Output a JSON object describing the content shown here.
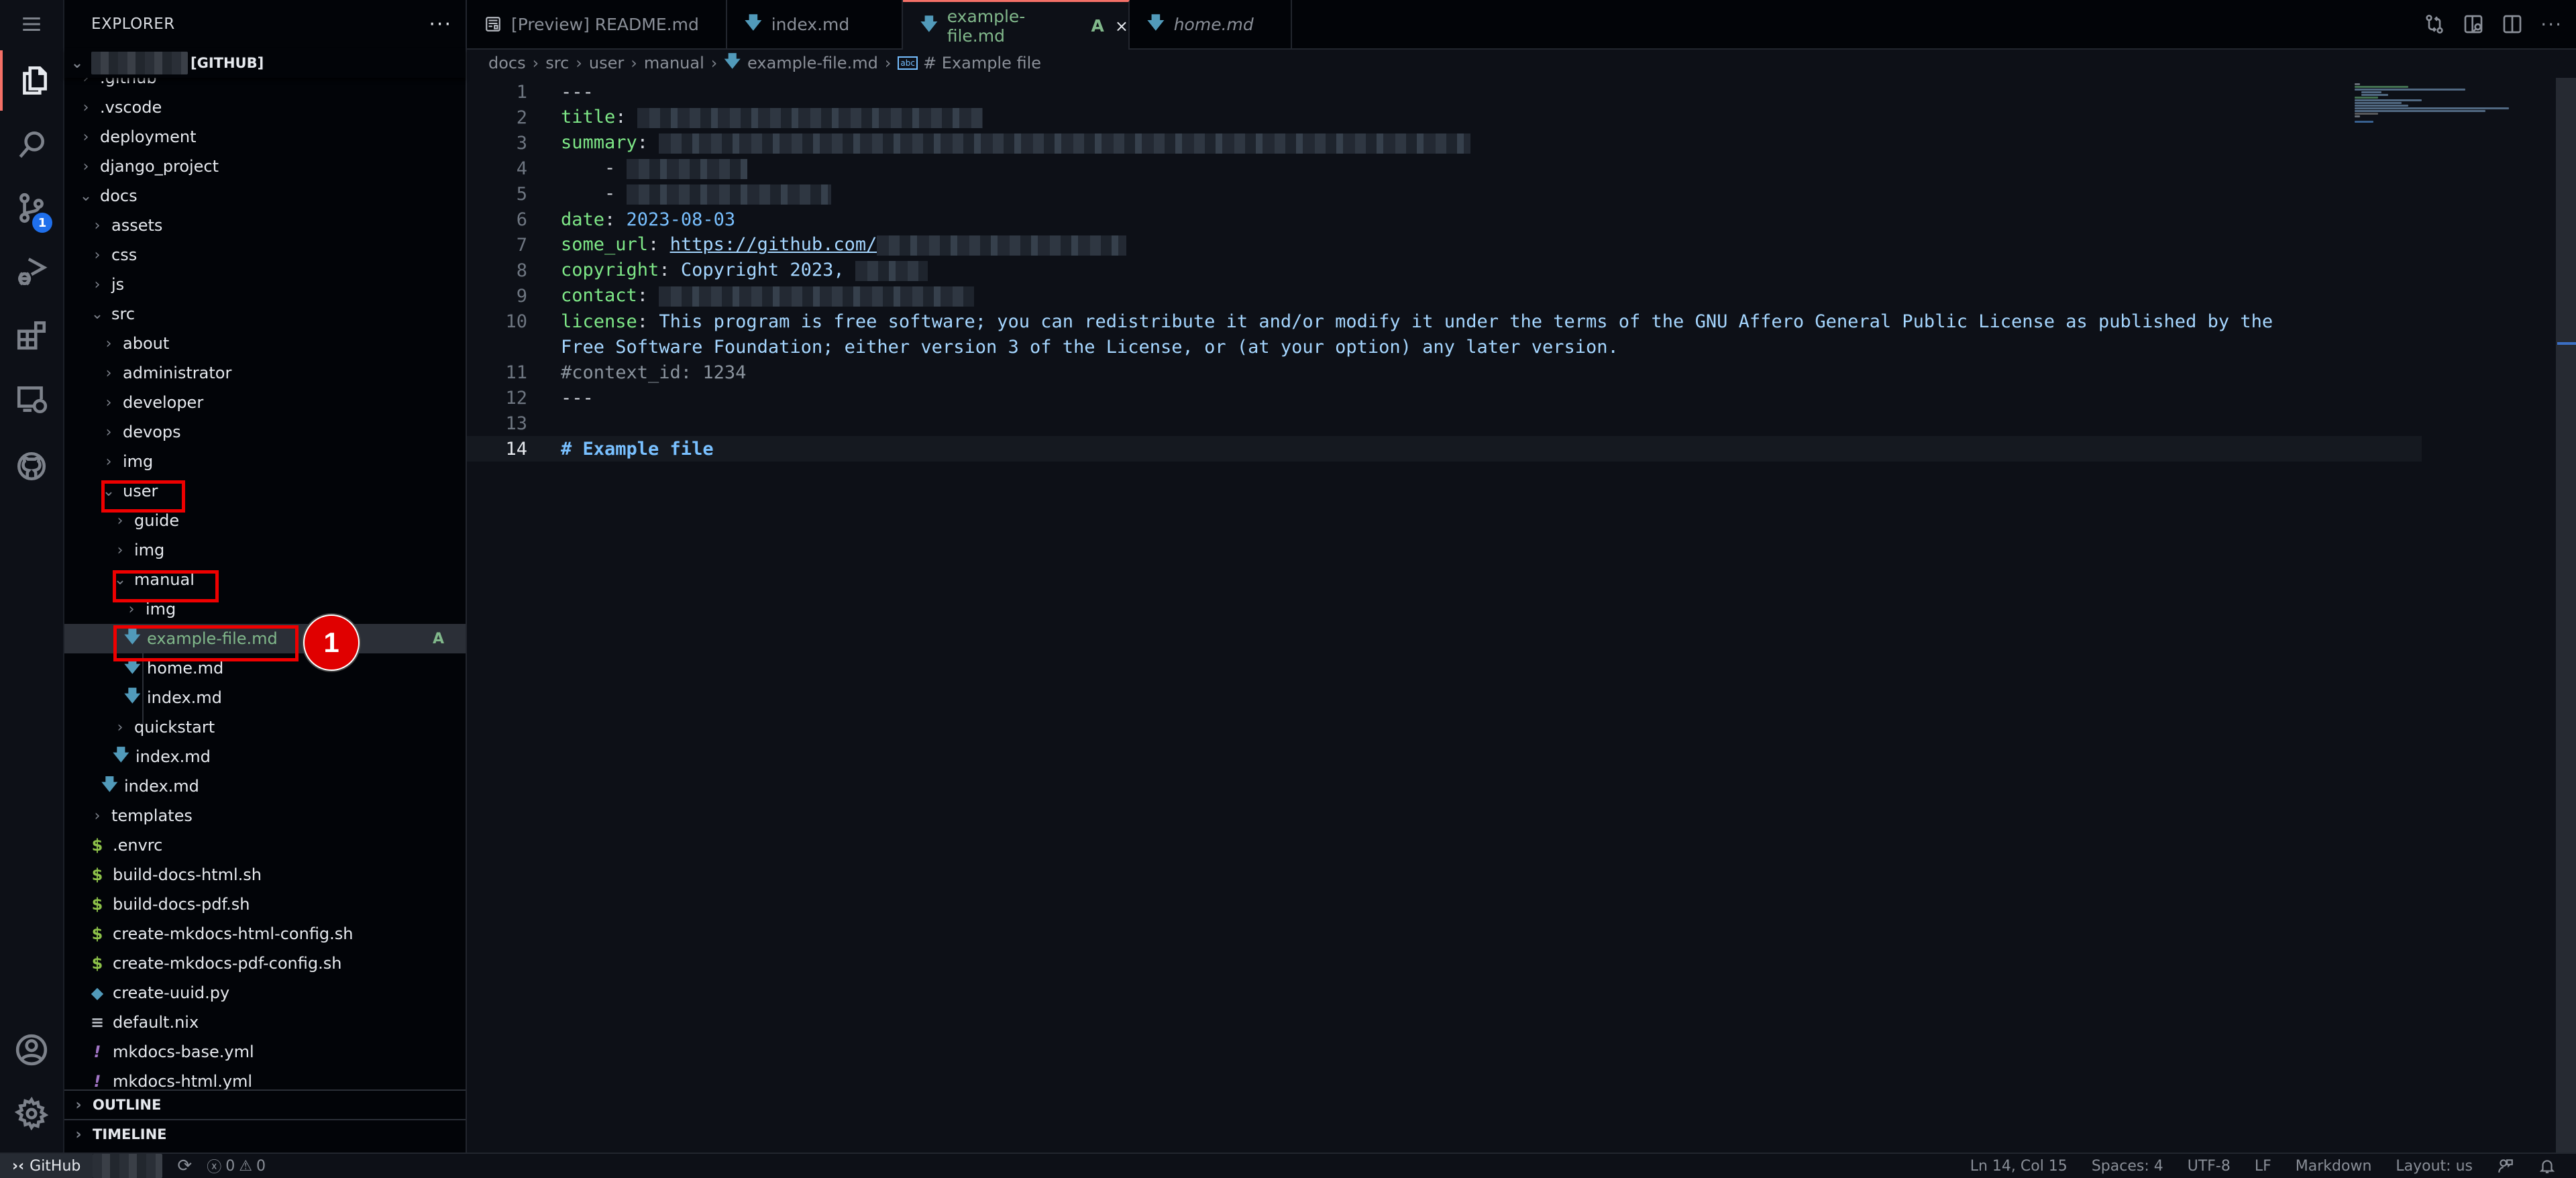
{
  "activity_bar": {
    "items": [
      {
        "name": "explorer",
        "icon": "files-icon",
        "active": true
      },
      {
        "name": "search",
        "icon": "search-icon"
      },
      {
        "name": "source-control",
        "icon": "source-control-icon",
        "badge": "1"
      },
      {
        "name": "run-debug",
        "icon": "run-debug-icon"
      },
      {
        "name": "extensions",
        "icon": "extensions-icon"
      },
      {
        "name": "remote-explorer",
        "icon": "remote-explorer-icon"
      },
      {
        "name": "github",
        "icon": "github-icon"
      }
    ],
    "bottom": [
      {
        "name": "accounts",
        "icon": "account-icon"
      },
      {
        "name": "manage",
        "icon": "gear-icon"
      }
    ],
    "accent": "#f47067"
  },
  "sidebar": {
    "title": "EXPLORER",
    "more": "···",
    "root_suffix": "[GITHUB]",
    "tree": [
      {
        "label": ".github",
        "type": "folder",
        "expanded": false,
        "depth": 1
      },
      {
        "label": ".vscode",
        "type": "folder",
        "expanded": false,
        "depth": 1
      },
      {
        "label": "deployment",
        "type": "folder",
        "expanded": false,
        "depth": 1
      },
      {
        "label": "django_project",
        "type": "folder",
        "expanded": false,
        "depth": 1
      },
      {
        "label": "docs",
        "type": "folder",
        "expanded": true,
        "depth": 1
      },
      {
        "label": "assets",
        "type": "folder",
        "expanded": false,
        "depth": 2
      },
      {
        "label": "css",
        "type": "folder",
        "expanded": false,
        "depth": 2
      },
      {
        "label": "js",
        "type": "folder",
        "expanded": false,
        "depth": 2
      },
      {
        "label": "src",
        "type": "folder",
        "expanded": true,
        "depth": 2
      },
      {
        "label": "about",
        "type": "folder",
        "expanded": false,
        "depth": 3
      },
      {
        "label": "administrator",
        "type": "folder",
        "expanded": false,
        "depth": 3
      },
      {
        "label": "developer",
        "type": "folder",
        "expanded": false,
        "depth": 3
      },
      {
        "label": "devops",
        "type": "folder",
        "expanded": false,
        "depth": 3
      },
      {
        "label": "img",
        "type": "folder",
        "expanded": false,
        "depth": 3
      },
      {
        "label": "user",
        "type": "folder",
        "expanded": true,
        "depth": 3,
        "highlighted": true
      },
      {
        "label": "guide",
        "type": "folder",
        "expanded": false,
        "depth": 4
      },
      {
        "label": "img",
        "type": "folder",
        "expanded": false,
        "depth": 4
      },
      {
        "label": "manual",
        "type": "folder",
        "expanded": true,
        "depth": 4,
        "highlighted": true
      },
      {
        "label": "img",
        "type": "folder",
        "expanded": false,
        "depth": 5
      },
      {
        "label": "example-file.md",
        "type": "md",
        "depth": 5,
        "selected": true,
        "git_status": "A",
        "highlighted": true
      },
      {
        "label": "home.md",
        "type": "md",
        "depth": 5
      },
      {
        "label": "index.md",
        "type": "md",
        "depth": 5
      },
      {
        "label": "quickstart",
        "type": "folder",
        "expanded": false,
        "depth": 4
      },
      {
        "label": "index.md",
        "type": "md",
        "depth": 4
      },
      {
        "label": "index.md",
        "type": "md",
        "depth": 3
      },
      {
        "label": "templates",
        "type": "folder",
        "expanded": false,
        "depth": 2
      },
      {
        "label": ".envrc",
        "type": "sh",
        "depth": 2
      },
      {
        "label": "build-docs-html.sh",
        "type": "sh",
        "depth": 2
      },
      {
        "label": "build-docs-pdf.sh",
        "type": "sh",
        "depth": 2
      },
      {
        "label": "create-mkdocs-html-config.sh",
        "type": "sh",
        "depth": 2
      },
      {
        "label": "create-mkdocs-pdf-config.sh",
        "type": "sh",
        "depth": 2
      },
      {
        "label": "create-uuid.py",
        "type": "py",
        "depth": 2
      },
      {
        "label": "default.nix",
        "type": "nix",
        "depth": 2
      },
      {
        "label": "mkdocs-base.yml",
        "type": "yml",
        "depth": 2
      },
      {
        "label": "mkdocs-html.yml",
        "type": "yml",
        "depth": 2
      }
    ],
    "sections": [
      {
        "label": "OUTLINE"
      },
      {
        "label": "TIMELINE"
      }
    ],
    "annotation_marker": "1"
  },
  "tabs": [
    {
      "label": "[Preview] README.md",
      "icon": "preview-icon"
    },
    {
      "label": "index.md",
      "icon": "markdown-icon"
    },
    {
      "label": "example-file.md",
      "icon": "markdown-icon",
      "active": true,
      "state": "A",
      "close": "×"
    },
    {
      "label": "home.md",
      "icon": "markdown-icon",
      "italic": true
    }
  ],
  "editor_actions": [
    {
      "name": "open-changes",
      "icon": "git-compare-icon"
    },
    {
      "name": "open-preview-to-side",
      "icon": "preview-side-icon"
    },
    {
      "name": "split-editor",
      "icon": "split-editor-icon"
    },
    {
      "name": "more-actions",
      "icon": "more-icon",
      "label": "···"
    }
  ],
  "breadcrumb": {
    "parts": [
      "docs",
      "src",
      "user",
      "manual"
    ],
    "file": "example-file.md",
    "symbol_icon": "abc",
    "symbol": "# Example file",
    "separator": "›"
  },
  "editor": {
    "lines": [
      {
        "n": "1",
        "text": "---"
      },
      {
        "n": "2",
        "key": "title",
        "redacted": true
      },
      {
        "n": "3",
        "key": "summary",
        "redacted": true
      },
      {
        "n": "4",
        "list_item": "-",
        "redacted": true
      },
      {
        "n": "5",
        "list_item": "-",
        "redacted": true
      },
      {
        "n": "6",
        "key": "date",
        "value": "2023-08-03"
      },
      {
        "n": "7",
        "key": "some_url",
        "value": "https://github.com/",
        "redacted_suffix": true
      },
      {
        "n": "8",
        "key": "copyright",
        "value": "Copyright 2023, ",
        "redacted_suffix": true
      },
      {
        "n": "9",
        "key": "contact",
        "redacted": true
      },
      {
        "n": "10",
        "key": "license",
        "value": "This program is free software; you can redistribute it and/or modify it under the terms of the GNU Affero General Public License as published by the",
        "wrap": "Free Software Foundation; either version 3 of the License, or (at your option) any later version."
      },
      {
        "n": "11",
        "comment": "#context_id: 1234"
      },
      {
        "n": "12",
        "text": "---"
      },
      {
        "n": "13",
        "text": ""
      },
      {
        "n": "14",
        "heading": "# Example file",
        "current": true
      }
    ]
  },
  "statusbar": {
    "remote": "GitHub",
    "errors": "0",
    "warnings": "0",
    "position": "Ln 14, Col 15",
    "indent": "Spaces: 4",
    "encoding": "UTF-8",
    "eol": "LF",
    "language": "Markdown",
    "layout": "Layout: us"
  }
}
